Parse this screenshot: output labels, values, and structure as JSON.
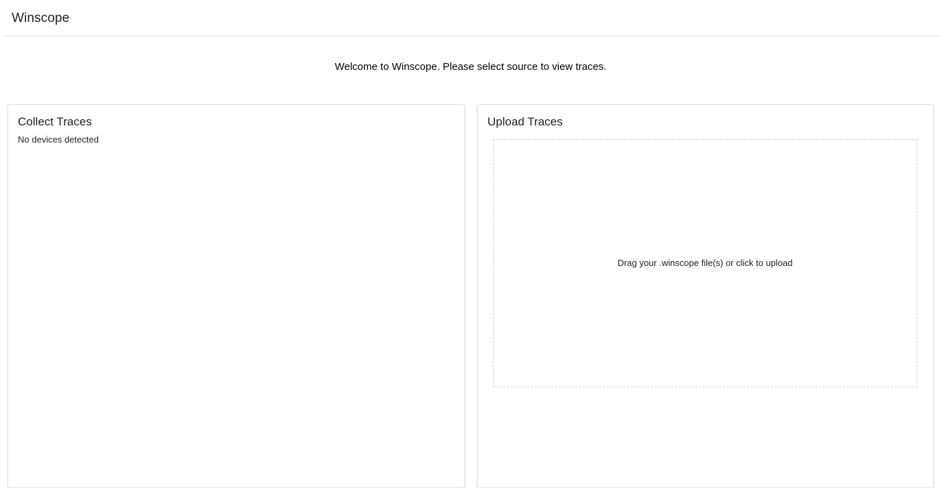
{
  "app": {
    "title": "Winscope"
  },
  "main": {
    "welcome_text": "Welcome to Winscope. Please select source to view traces."
  },
  "collect_card": {
    "title": "Collect Traces",
    "status": "No devices detected"
  },
  "upload_card": {
    "title": "Upload Traces",
    "drop_zone_text": "Drag your .winscope file(s) or click to upload"
  }
}
